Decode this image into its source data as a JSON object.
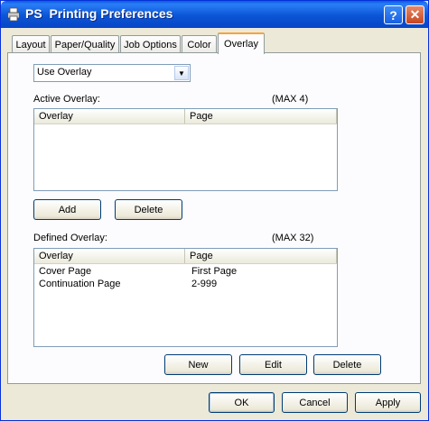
{
  "window": {
    "title": "PS  Printing Preferences",
    "help_label": "?",
    "close_label": "✕"
  },
  "tabs": [
    {
      "label": "Layout"
    },
    {
      "label": "Paper/Quality"
    },
    {
      "label": "Job Options"
    },
    {
      "label": "Color"
    },
    {
      "label": "Overlay",
      "active": true
    }
  ],
  "overlay_mode": {
    "selected": "Use Overlay",
    "arrow": "▼"
  },
  "active_overlay": {
    "label": "Active Overlay:",
    "max": "(MAX 4)",
    "columns": [
      "Overlay",
      "Page"
    ],
    "rows": []
  },
  "active_buttons": {
    "add": "Add",
    "delete": "Delete"
  },
  "defined_overlay": {
    "label": "Defined Overlay:",
    "max": "(MAX 32)",
    "columns": [
      "Overlay",
      "Page"
    ],
    "rows": [
      {
        "overlay": "Cover Page",
        "page": "First Page"
      },
      {
        "overlay": "Continuation Page",
        "page": "2-999"
      }
    ]
  },
  "defined_buttons": {
    "new": "New",
    "edit": "Edit",
    "delete": "Delete"
  },
  "dialog_buttons": {
    "ok": "OK",
    "cancel": "Cancel",
    "apply": "Apply"
  },
  "colors": {
    "titlebar": "#0a55d6",
    "dialog_bg": "#ece9d8",
    "active_tab_accent": "#f8a338"
  }
}
